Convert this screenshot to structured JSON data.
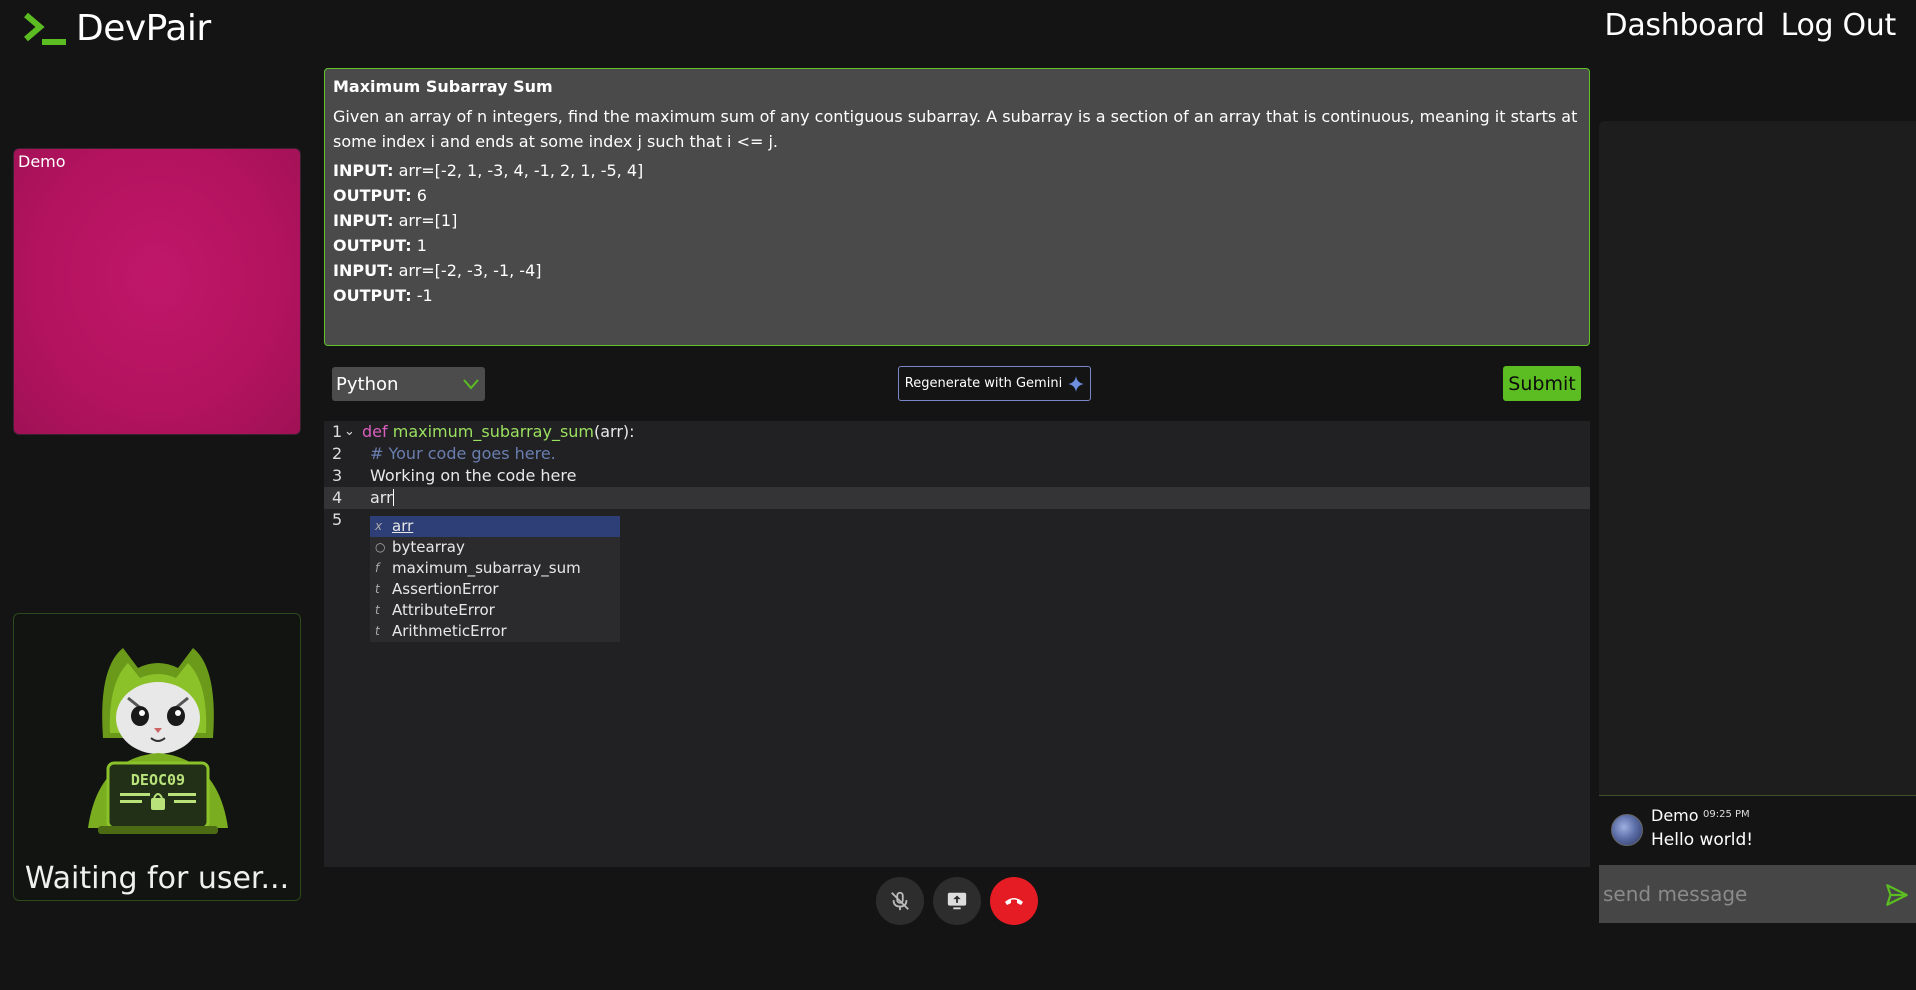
{
  "header": {
    "app_name": "DevPair",
    "nav": {
      "dashboard": "Dashboard",
      "logout": "Log Out"
    }
  },
  "video": {
    "user_label": "Demo",
    "waiting_text": "Waiting for user...",
    "avatar_text": "DEOC09",
    "user_tile_color": "#b3135f"
  },
  "problem": {
    "title": "Maximum Subarray Sum",
    "description": "Given an array of n integers, find the maximum sum of any contiguous subarray. A subarray is a section of an array that is continuous, meaning it starts at some index i and ends at some index j such that i <= j.",
    "examples": [
      {
        "input_label": "INPUT:",
        "input": "arr=[-2, 1, -3, 4, -1, 2, 1, -5, 4]",
        "output_label": "OUTPUT:",
        "output": "6"
      },
      {
        "input_label": "INPUT:",
        "input": "arr=[1]",
        "output_label": "OUTPUT:",
        "output": "1"
      },
      {
        "input_label": "INPUT:",
        "input": "arr=[-2, -3, -1, -4]",
        "output_label": "OUTPUT:",
        "output": "-1"
      }
    ]
  },
  "controls": {
    "language": "Python",
    "regenerate_label": "Regenerate with Gemini",
    "submit_label": "Submit"
  },
  "editor": {
    "lines": [
      {
        "number": "1",
        "keyword": "def",
        "function": "maximum_subarray_sum",
        "rest": "(arr):"
      },
      {
        "number": "2",
        "comment": "# Your code goes here."
      },
      {
        "number": "3",
        "text": "Working on the code here"
      },
      {
        "number": "4",
        "text": "arr"
      },
      {
        "number": "5",
        "text": ""
      }
    ],
    "autocomplete": [
      {
        "kind": "x",
        "label": "arr"
      },
      {
        "kind": "○",
        "label": "bytearray"
      },
      {
        "kind": "f",
        "label": "maximum_subarray_sum"
      },
      {
        "kind": "t",
        "label": "AssertionError"
      },
      {
        "kind": "t",
        "label": "AttributeError"
      },
      {
        "kind": "t",
        "label": "ArithmeticError"
      }
    ]
  },
  "chat": {
    "messages": [
      {
        "name": "Demo",
        "time": "09:25 PM",
        "text": "Hello world!"
      }
    ],
    "input_placeholder": "send message"
  },
  "colors": {
    "accent": "#5bbd21",
    "hangup": "#e51c23",
    "panel_border": "#63c22a"
  }
}
